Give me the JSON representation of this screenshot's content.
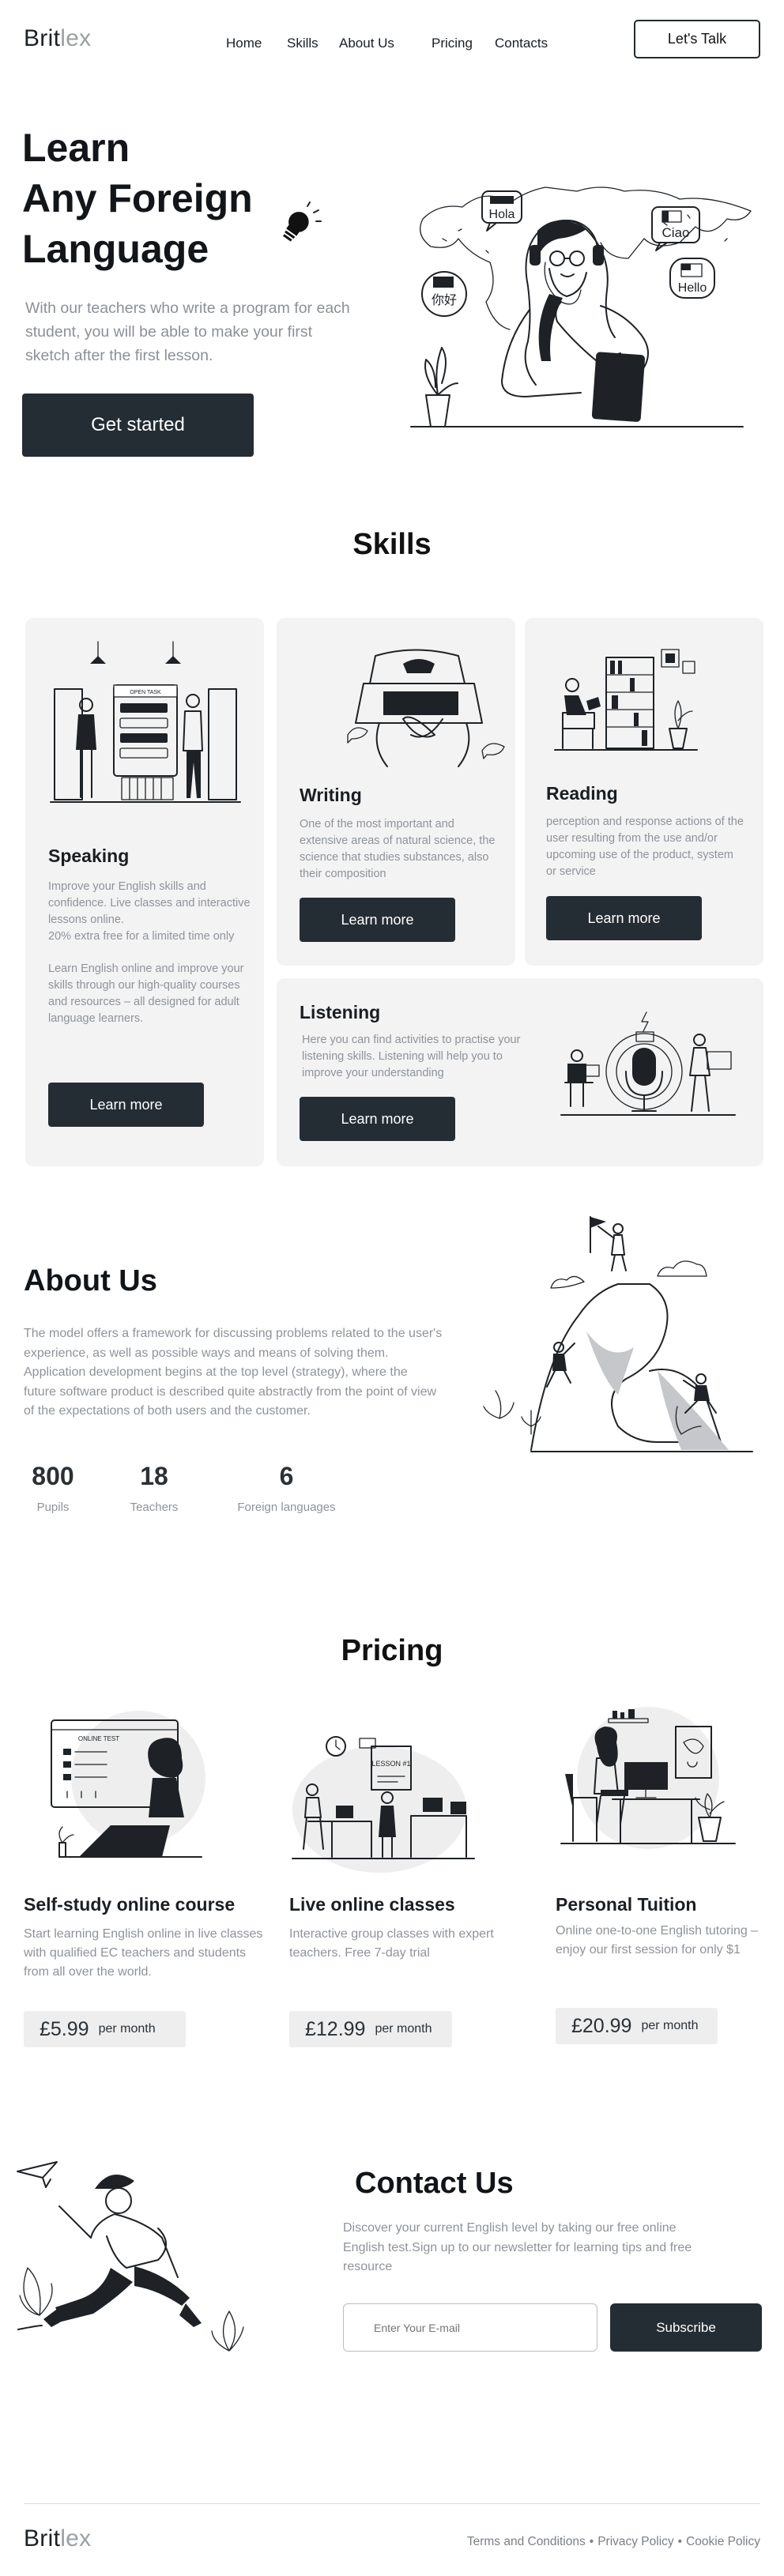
{
  "brand": {
    "part1": "Brit",
    "part2": "lex"
  },
  "nav": {
    "items": [
      "Home",
      "Skills",
      "About Us",
      "Pricing",
      "Contacts"
    ],
    "cta": "Let's Talk"
  },
  "hero": {
    "title_line1": "Learn",
    "title_line2": "Any Foreign",
    "title_line3": "Language",
    "description": "With our teachers who write a program for each student, you will be able to make your first sketch after the first lesson.",
    "cta": "Get started",
    "bubbles": [
      "Hola",
      "Ciao",
      "你好",
      "Hello"
    ]
  },
  "skills": {
    "title": "Skills",
    "speaking": {
      "title": "Speaking",
      "text1": "Improve your English skills and confidence. Live classes and interactive lessons online.",
      "text2": "20% extra free for a limited time only",
      "text3": "Learn English online and improve your",
      "text4": "skills through our high-quality courses and resources – all designed for adult language learners.",
      "button": "Learn more",
      "screen_text": "OPEN TASK"
    },
    "writing": {
      "title": "Writing",
      "text": "One of the most important and extensive areas of natural science, the science that studies substances, also their composition",
      "button": "Learn more"
    },
    "reading": {
      "title": "Reading",
      "text": "perception and response actions of the user resulting from the use and/or upcoming use of the product, system or service",
      "button": "Learn more"
    },
    "listening": {
      "title": "Listening",
      "text": "Here you can find activities to practise your listening skills. Listening will help you to improve your understanding",
      "button": "Learn more"
    }
  },
  "about": {
    "title": "About Us",
    "text": "The model offers a framework for discussing problems related to the user's experience, as well as possible ways and means of solving them. Application development begins at the top level (strategy), where the future software product is described quite abstractly from the point of view of the expectations of both users and the customer.",
    "stats": [
      {
        "value": "800",
        "label": "Pupils"
      },
      {
        "value": "18",
        "label": "Teachers"
      },
      {
        "value": "6",
        "label": "Foreign languages"
      }
    ]
  },
  "pricing": {
    "title": "Pricing",
    "plans": [
      {
        "title": "Self-study online course",
        "text": "Start learning English online in live classes with qualified EC teachers and students from all over the world.",
        "price": "£5.99",
        "period": "per month",
        "screen_text": "ONLINE TEST"
      },
      {
        "title": "Live online classes",
        "text": "Interactive group classes with expert teachers. Free 7-day trial",
        "price": "£12.99",
        "period": "per month",
        "board_text": "LESSON #1"
      },
      {
        "title": "Personal Tuition",
        "text": "Online one-to-one English tutoring – enjoy our first session for only $1",
        "price": "£20.99",
        "period": "per month"
      }
    ]
  },
  "contact": {
    "title": "Contact Us",
    "text": "Discover your current English level by taking our free online English test.Sign up to our newsletter for learning tips and free resource",
    "email_placeholder": "Enter Your E-mail",
    "button": "Subscribe"
  },
  "footer": {
    "links": [
      "Terms and Conditions",
      "Privacy Policy",
      "Cookie Policy"
    ],
    "separator": "•"
  },
  "colors": {
    "dark": "#252d34",
    "muted_text": "#8e939a",
    "card_bg": "#f3f3f3"
  },
  "icons": [
    "lightbulb-icon",
    "paper-plane-icon",
    "flag-icon"
  ]
}
